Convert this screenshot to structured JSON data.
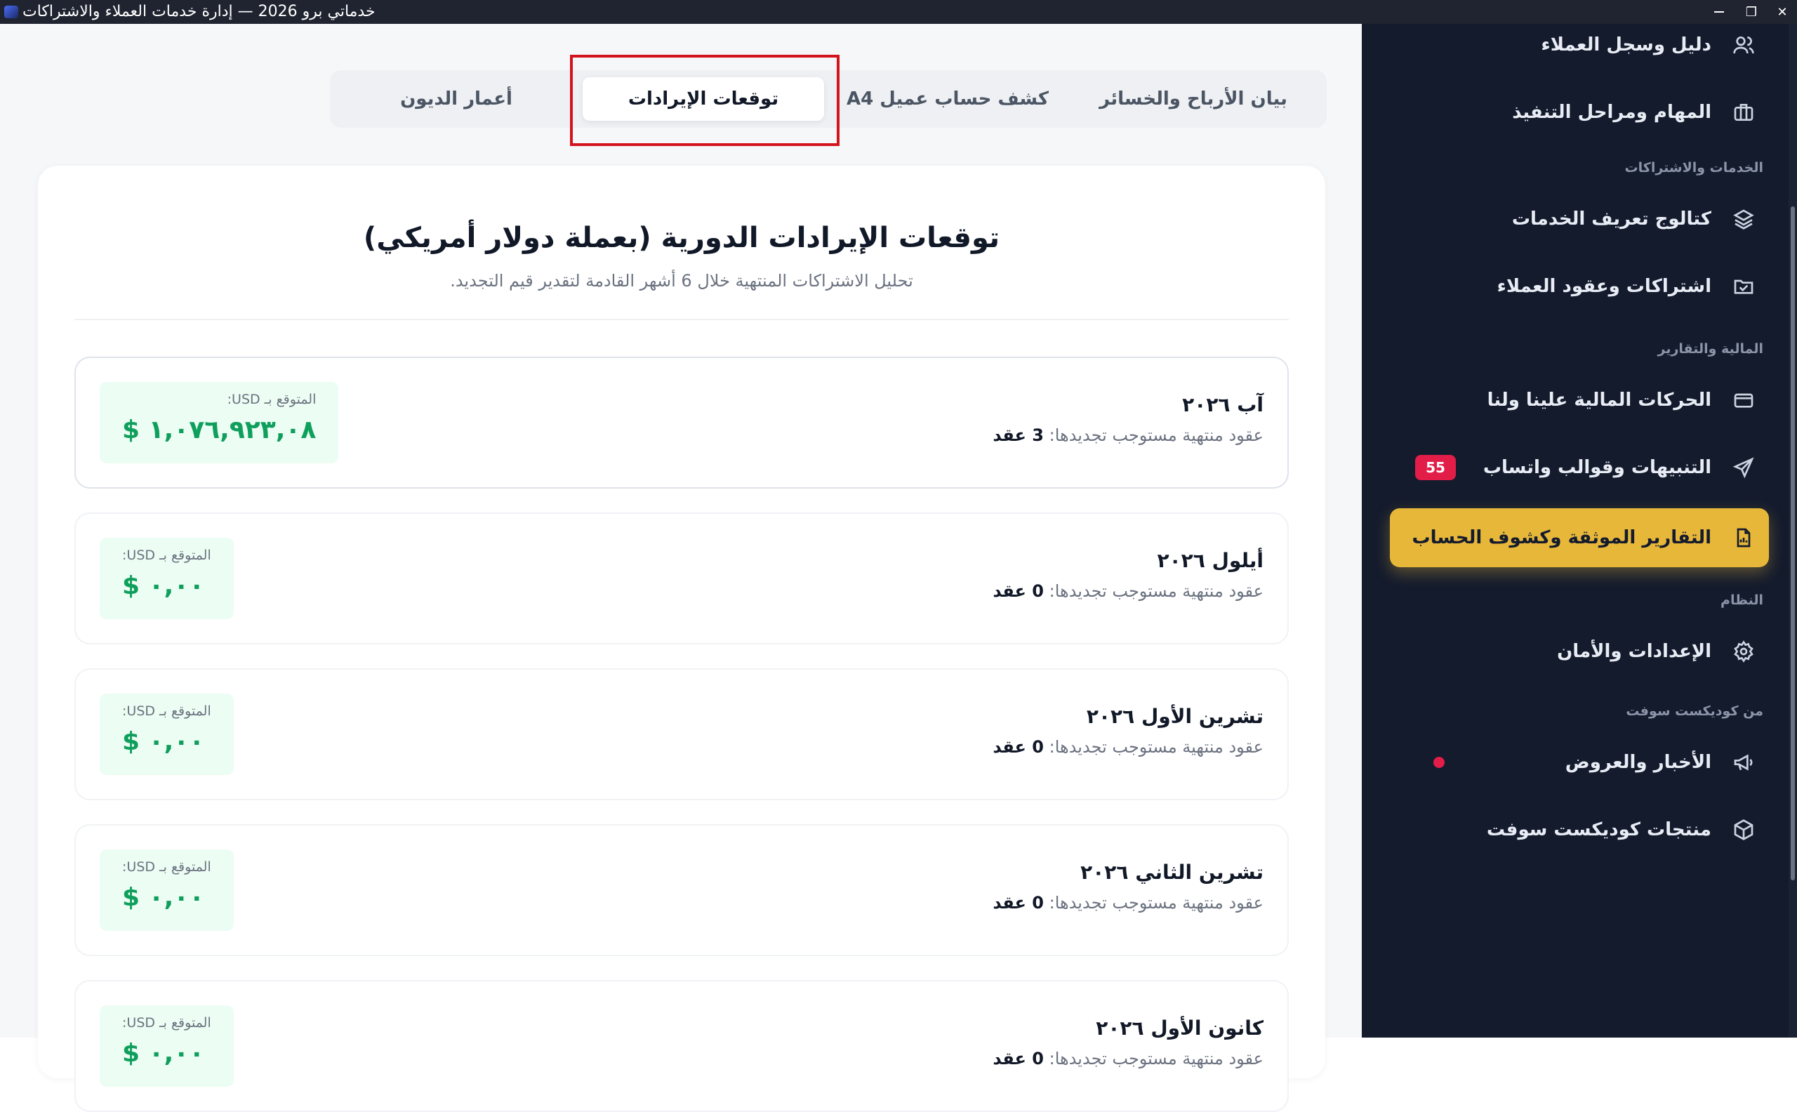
{
  "window": {
    "title": "خدماتي برو 2026 — إدارة خدمات العملاء والاشتراكات",
    "restore_glyph": "❐",
    "close_glyph": "✕"
  },
  "sidebar": {
    "items": [
      {
        "label": "دليل وسجل العملاء",
        "icon": "users-icon"
      },
      {
        "label": "المهام ومراحل التنفيذ",
        "icon": "briefcase-icon"
      },
      {
        "label": "كتالوج تعريف الخدمات",
        "icon": "layers-icon"
      },
      {
        "label": "اشتراكات وعقود العملاء",
        "icon": "folder-check-icon"
      },
      {
        "label": "الحركات المالية علينا ولنا",
        "icon": "credit-card-icon"
      },
      {
        "label": "التنبيهات وقوالب واتساب",
        "icon": "send-icon",
        "badge": "55"
      },
      {
        "label": "التقارير الموثقة وكشوف الحساب",
        "icon": "report-file-icon",
        "active": true
      },
      {
        "label": "الإعدادات والأمان",
        "icon": "gear-icon"
      },
      {
        "label": "الأخبار والعروض",
        "icon": "megaphone-icon"
      },
      {
        "label": "منتجات كوديكست سوفت",
        "icon": "box-icon"
      }
    ],
    "sections": {
      "services": "الخدمات والاشتراكات",
      "finance": "المالية والتقارير",
      "system": "النظام",
      "vendor": "من كوديكست سوفت"
    }
  },
  "tabs": [
    {
      "label": "بيان الأرباح والخسائر"
    },
    {
      "label": "كشف حساب عميل A4"
    },
    {
      "label": "توقعات الإيرادات",
      "active": true
    },
    {
      "label": "أعمار الديون"
    }
  ],
  "report": {
    "title": "توقعات الإيرادات الدورية (بعملة دولار أمريكي)",
    "subtitle": "تحليل الاشتراكات المنتهية خلال 6 أشهر القادمة لتقدير قيم التجديد.",
    "sub_prefix": "عقود منتهية مستوجب تجديدها:",
    "amount_label": "المتوقع بـ USD:",
    "rows": [
      {
        "month": "آب ٢٠٢٦",
        "count": "3 عقد",
        "amount": "$ ١,٠٧٦,٩٢٣,٠٨"
      },
      {
        "month": "أيلول ٢٠٢٦",
        "count": "0 عقد",
        "amount": "$ ٠,٠٠"
      },
      {
        "month": "تشرين الأول ٢٠٢٦",
        "count": "0 عقد",
        "amount": "$ ٠,٠٠"
      },
      {
        "month": "تشرين الثاني ٢٠٢٦",
        "count": "0 عقد",
        "amount": "$ ٠,٠٠"
      },
      {
        "month": "كانون الأول ٢٠٢٦",
        "count": "0 عقد",
        "amount": "$ ٠,٠٠"
      }
    ]
  },
  "colors": {
    "sidebar_bg": "#141b2d",
    "accent": "#e7b73a",
    "badge": "#e11d48",
    "amount_green": "#0f9f5c",
    "highlight_red": "#d3131d"
  }
}
